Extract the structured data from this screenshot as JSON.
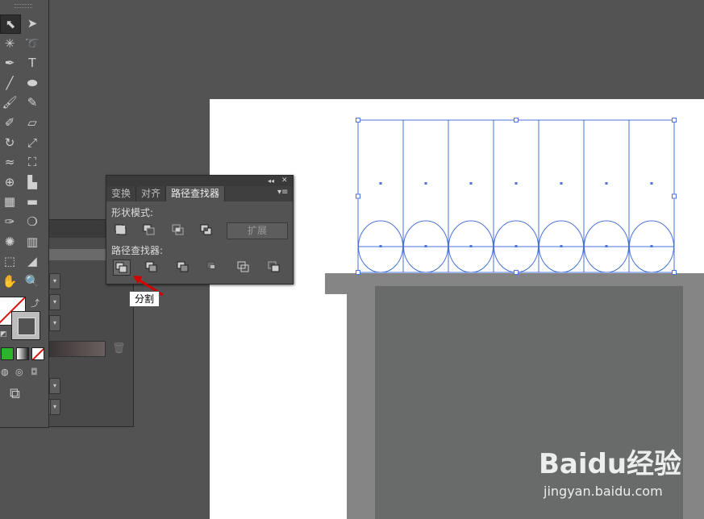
{
  "pathfinder_panel": {
    "tabs": [
      "变换",
      "对齐",
      "路径查找器"
    ],
    "active_tab": 2,
    "collapse_icon": "double-chevron-icon",
    "close_icon": "close-icon",
    "menu_icon": "panel-menu-icon",
    "shape_modes_label": "形状模式:",
    "shape_modes": [
      "unite-icon",
      "minus-front-icon",
      "intersect-icon",
      "exclude-icon"
    ],
    "expand_label": "扩展",
    "pathfinders_label": "路径查找器:",
    "pathfinders": [
      "divide-icon",
      "trim-icon",
      "merge-icon",
      "crop-icon",
      "outline-icon",
      "minus-back-icon"
    ],
    "active_pathfinder": 0
  },
  "tooltip": {
    "text": "分割"
  },
  "tools": [
    {
      "name": "selection-tool",
      "glyph": "⬉"
    },
    {
      "name": "direct-selection-tool",
      "glyph": "➤"
    },
    {
      "name": "magic-wand-tool",
      "glyph": "✳"
    },
    {
      "name": "lasso-tool",
      "glyph": "➰"
    },
    {
      "name": "pen-tool",
      "glyph": "✒"
    },
    {
      "name": "type-tool",
      "glyph": "T"
    },
    {
      "name": "line-tool",
      "glyph": "╱"
    },
    {
      "name": "ellipse-tool",
      "glyph": "⬬"
    },
    {
      "name": "paintbrush-tool",
      "glyph": "🖌"
    },
    {
      "name": "pencil-tool",
      "glyph": "✎"
    },
    {
      "name": "blob-brush-tool",
      "glyph": "✐"
    },
    {
      "name": "eraser-tool",
      "glyph": "▱"
    },
    {
      "name": "rotate-tool",
      "glyph": "↻"
    },
    {
      "name": "scale-tool",
      "glyph": "⤢"
    },
    {
      "name": "width-tool",
      "glyph": "≈"
    },
    {
      "name": "free-transform-tool",
      "glyph": "⛶"
    },
    {
      "name": "shape-builder-tool",
      "glyph": "⊕"
    },
    {
      "name": "chart-tool",
      "glyph": "▙"
    },
    {
      "name": "mesh-tool",
      "glyph": "▦"
    },
    {
      "name": "gradient-tool",
      "glyph": "▬"
    },
    {
      "name": "eyedropper-tool",
      "glyph": "✑"
    },
    {
      "name": "blend-tool",
      "glyph": "❍"
    },
    {
      "name": "symbol-sprayer-tool",
      "glyph": "✺"
    },
    {
      "name": "column-graph-tool",
      "glyph": "▥"
    },
    {
      "name": "artboard-tool",
      "glyph": "⬚"
    },
    {
      "name": "slice-tool",
      "glyph": "◢"
    },
    {
      "name": "hand-tool",
      "glyph": "✋"
    },
    {
      "name": "zoom-tool",
      "glyph": "🔍"
    }
  ],
  "colors": {
    "selection": "#4a72d8",
    "artboard": "#ffffff",
    "shelf": "#858585",
    "shelf_inner": "#696b6b",
    "arrow": "#d40000"
  },
  "watermark": {
    "brand": "Baidu经验",
    "url": "jingyan.baidu.com"
  }
}
